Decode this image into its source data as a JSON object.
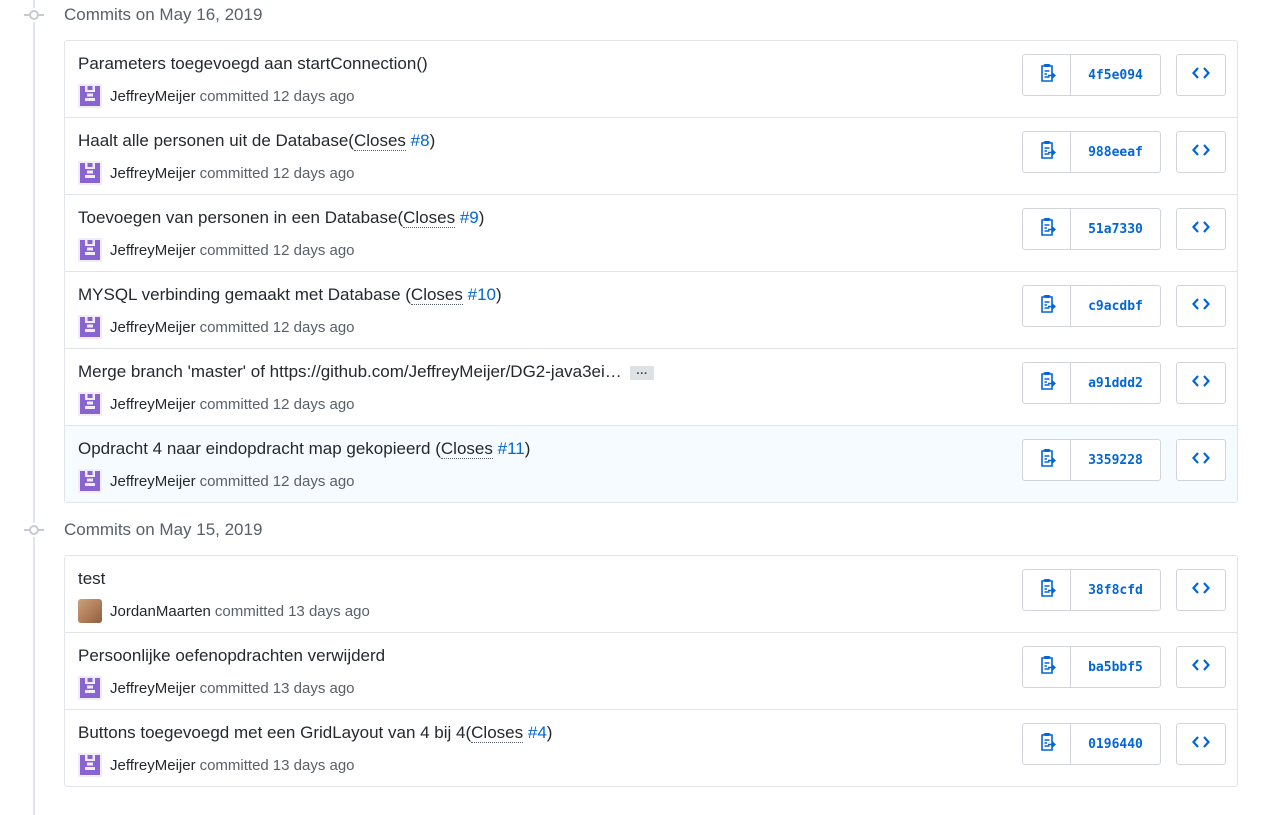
{
  "groups": [
    {
      "header": "Commits on May 16, 2019",
      "commits": [
        {
          "message": "Parameters toegevoegd aan startConnection()",
          "closes": "",
          "issue": "",
          "suffix": "",
          "author": "JeffreyMeijer",
          "verb": "committed",
          "time": "12 days ago",
          "sha": "4f5e094",
          "avatar": "identicon",
          "highlighted": false,
          "truncated": false
        },
        {
          "message": "Haalt alle personen uit de Database(",
          "closes": "Closes",
          "issue": "#8",
          "suffix": ")",
          "author": "JeffreyMeijer",
          "verb": "committed",
          "time": "12 days ago",
          "sha": "988eeaf",
          "avatar": "identicon",
          "highlighted": false,
          "truncated": false
        },
        {
          "message": "Toevoegen van personen in een Database(",
          "closes": "Closes",
          "issue": "#9",
          "suffix": ")",
          "author": "JeffreyMeijer",
          "verb": "committed",
          "time": "12 days ago",
          "sha": "51a7330",
          "avatar": "identicon",
          "highlighted": false,
          "truncated": false
        },
        {
          "message": "MYSQL verbinding gemaakt met Database (",
          "closes": "Closes",
          "issue": "#10",
          "suffix": ")",
          "author": "JeffreyMeijer",
          "verb": "committed",
          "time": "12 days ago",
          "sha": "c9acdbf",
          "avatar": "identicon",
          "highlighted": false,
          "truncated": false
        },
        {
          "message": "Merge branch 'master' of https://github.com/JeffreyMeijer/DG2-java3ei…",
          "closes": "",
          "issue": "",
          "suffix": "",
          "author": "JeffreyMeijer",
          "verb": "committed",
          "time": "12 days ago",
          "sha": "a91ddd2",
          "avatar": "identicon",
          "highlighted": false,
          "truncated": true
        },
        {
          "message": "Opdracht 4 naar eindopdracht map gekopieerd (",
          "closes": "Closes",
          "issue": "#11",
          "suffix": ")",
          "author": "JeffreyMeijer",
          "verb": "committed",
          "time": "12 days ago",
          "sha": "3359228",
          "avatar": "identicon",
          "highlighted": true,
          "truncated": false
        }
      ]
    },
    {
      "header": "Commits on May 15, 2019",
      "commits": [
        {
          "message": "test",
          "closes": "",
          "issue": "",
          "suffix": "",
          "author": "JordanMaarten",
          "verb": "committed",
          "time": "13 days ago",
          "sha": "38f8cfd",
          "avatar": "photo",
          "highlighted": false,
          "truncated": false
        },
        {
          "message": "Persoonlijke oefenopdrachten verwijderd",
          "closes": "",
          "issue": "",
          "suffix": "",
          "author": "JeffreyMeijer",
          "verb": "committed",
          "time": "13 days ago",
          "sha": "ba5bbf5",
          "avatar": "identicon",
          "highlighted": false,
          "truncated": false
        },
        {
          "message": "Buttons toegevoegd met een GridLayout van 4 bij 4(",
          "closes": "Closes",
          "issue": "#4",
          "suffix": ")",
          "author": "JeffreyMeijer",
          "verb": "committed",
          "time": "13 days ago",
          "sha": "0196440",
          "avatar": "identicon",
          "highlighted": false,
          "truncated": false
        }
      ]
    }
  ],
  "ellipsis_label": "…",
  "icons": {
    "timeline": "git-commit-icon",
    "copy": "clippy-icon",
    "browse": "code-icon"
  },
  "colors": {
    "link": "#0366d6",
    "identicon": "#8a63d2",
    "highlight_row": "#f6fbff"
  }
}
